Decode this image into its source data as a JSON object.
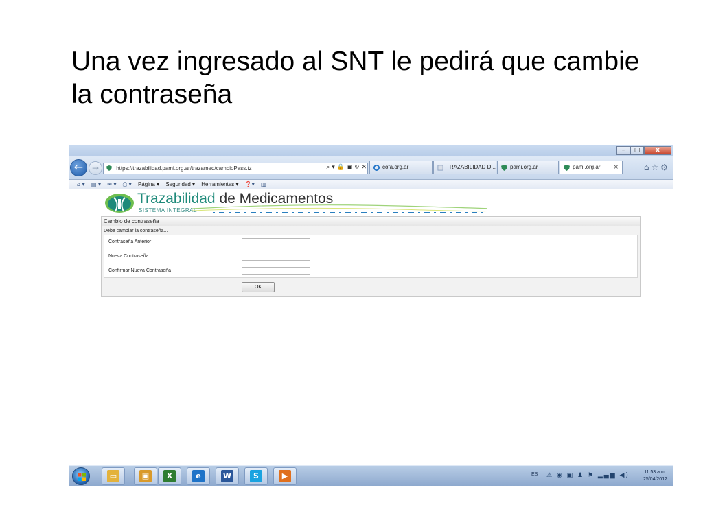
{
  "slide": {
    "title": "Una vez ingresado al SNT le pedirá que cambie la contraseña"
  },
  "browser": {
    "window_controls": {
      "minimize": "–",
      "maximize": "▢",
      "close": "x"
    },
    "address": "https://trazabilidad.pami.org.ar/trazamed/cambioPass.tz",
    "address_tools": "⌕ ▾ 🔒 ▣ ↻ ✕",
    "tabs": [
      {
        "label": "cofa.org.ar",
        "active": false
      },
      {
        "label": "TRAZABILIDAD D...",
        "active": false
      },
      {
        "label": "pami.org.ar",
        "active": false
      },
      {
        "label": "pami.org.ar",
        "active": true,
        "close": "×"
      }
    ],
    "right_icons": "⌂☆⚙",
    "commandbar": {
      "home": "⌂ ▾",
      "feeds": "▤ ▾",
      "mail": "✉ ▾",
      "print": "⎙ ▾",
      "page": "Página ▾",
      "security": "Seguridad ▾",
      "tools": "Herramientas ▾",
      "help": "❓▾",
      "extra": "▥"
    }
  },
  "site": {
    "brand_primary": "Trazabilidad",
    "brand_secondary": " de Medicamentos",
    "subtitle": "SISTEMA INTEGRAL",
    "brand_color": "#1f8a7a"
  },
  "form": {
    "panel_title": "Cambio de contraseña",
    "message": "Debe cambiar la contraseña...",
    "fields": [
      {
        "label": "Contraseña Anterior",
        "value": ""
      },
      {
        "label": "Nueva Contraseña",
        "value": ""
      },
      {
        "label": "Confirmar Nueva Contraseña",
        "value": ""
      }
    ],
    "ok_label": "OK"
  },
  "taskbar": {
    "apps": [
      {
        "icon": "explorer-folder-icon",
        "glyph": "▭",
        "color": "#e3b23c"
      },
      {
        "icon": "contacts-icon",
        "glyph": "▣",
        "color": "#d99a2b"
      },
      {
        "icon": "excel-icon",
        "glyph": "X",
        "color": "#2e7d32"
      },
      {
        "icon": "internet-explorer-icon",
        "glyph": "e",
        "color": "#1e73c8"
      },
      {
        "icon": "word-icon",
        "glyph": "W",
        "color": "#2b579a"
      },
      {
        "icon": "skype-icon",
        "glyph": "S",
        "color": "#1aa3e0"
      },
      {
        "icon": "media-player-icon",
        "glyph": "▶",
        "color": "#e0701e"
      }
    ],
    "language": "ES",
    "tray_icons": "⚠ ◉ ▣ ♟ ⚑ ▂▄▆ ◀)",
    "time": "11:53 a.m.",
    "date": "25/04/2012"
  }
}
